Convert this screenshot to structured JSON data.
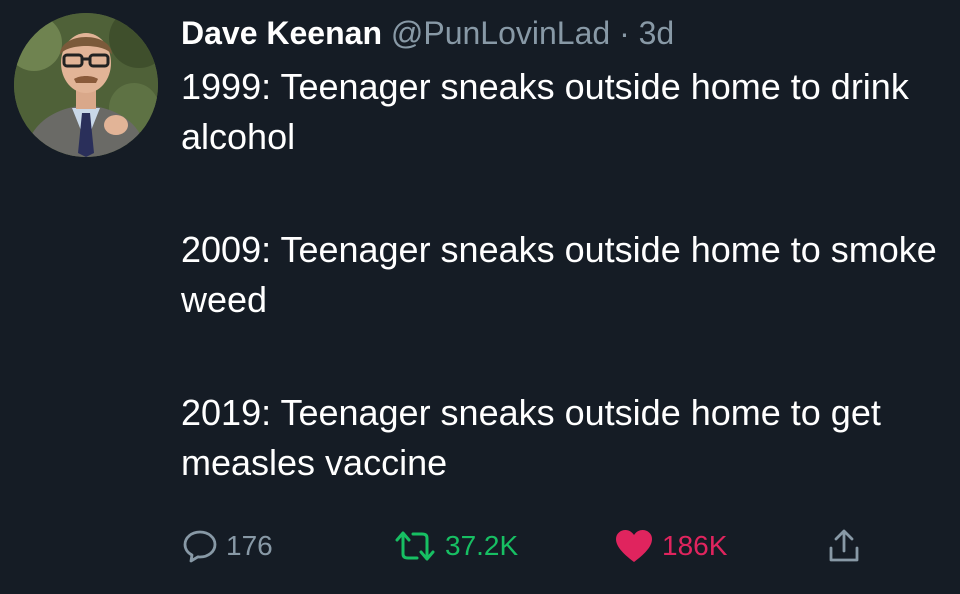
{
  "tweet": {
    "author": {
      "name": "Dave Keenan",
      "handle": "@PunLovinLad",
      "separator": "·",
      "time": "3d"
    },
    "paragraphs": [
      "1999: Teenager sneaks outside home to drink alcohol",
      "2009: Teenager sneaks outside home to smoke weed",
      "2019: Teenager sneaks outside home to get measles vaccine"
    ],
    "actions": {
      "reply": {
        "icon": "reply-icon",
        "count": "176"
      },
      "retweet": {
        "icon": "retweet-icon",
        "count": "37.2K",
        "color": "#17bf63"
      },
      "like": {
        "icon": "heart-icon",
        "count": "186K",
        "color": "#e0245e"
      },
      "share": {
        "icon": "share-icon"
      }
    }
  },
  "colors": {
    "background": "#151c25",
    "text": "#ffffff",
    "secondary_text": "#8899a6"
  }
}
